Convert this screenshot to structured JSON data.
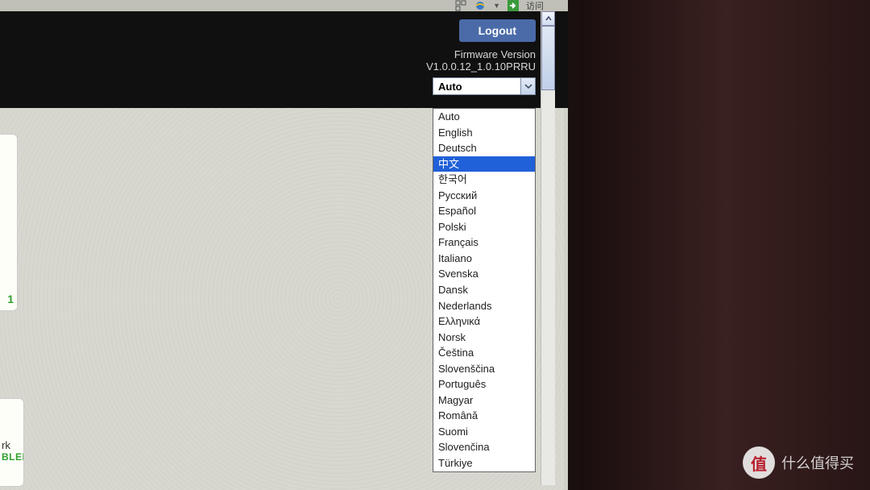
{
  "browser": {
    "visit_label": "访问"
  },
  "header": {
    "logout_label": "Logout",
    "firmware_label": "Firmware Version",
    "firmware_version": "V1.0.0.12_1.0.10PRRU"
  },
  "language_select": {
    "current": "Auto",
    "highlighted_index": 3,
    "options": [
      "Auto",
      "English",
      "Deutsch",
      "中文",
      "한국어",
      "Pусский",
      "Español",
      "Polski",
      "Français",
      "Italiano",
      "Svenska",
      "Dansk",
      "Nederlands",
      "Ελληνικά",
      "Norsk",
      "Čeština",
      "Slovenščina",
      "Português",
      "Magyar",
      "Română",
      "Suomi",
      "Slovenčina",
      "Türkiye"
    ]
  },
  "side": {
    "count": "1",
    "label_fragment": "rk",
    "status_fragment": "BLED"
  },
  "watermark": {
    "badge": "值",
    "text": "什么值得买"
  }
}
